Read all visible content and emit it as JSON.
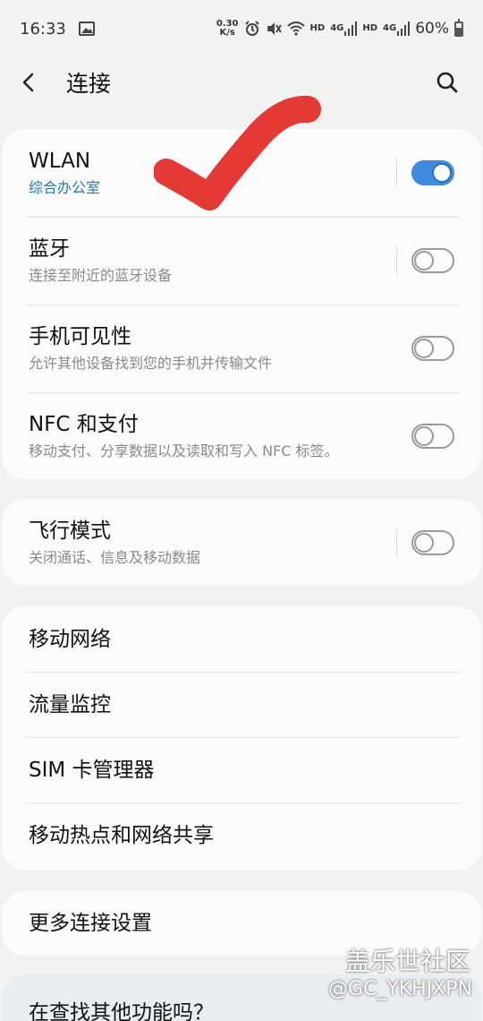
{
  "status_bar": {
    "time": "16:33",
    "net_speed_top": "0.30",
    "net_speed_bottom": "K/s",
    "hd1": "HD",
    "net1": "4G",
    "hd2": "HD",
    "net2": "4G",
    "battery": "60%"
  },
  "header": {
    "title": "连接"
  },
  "card1": {
    "rows": [
      {
        "title": "WLAN",
        "subtitle": "综合办公室",
        "toggle_on": true
      },
      {
        "title": "蓝牙",
        "subtitle": "连接至附近的蓝牙设备",
        "toggle_on": false
      },
      {
        "title": "手机可见性",
        "subtitle": "允许其他设备找到您的手机并传输文件",
        "toggle_on": false
      },
      {
        "title": "NFC 和支付",
        "subtitle": "移动支付、分享数据以及读取和写入 NFC 标签。",
        "toggle_on": false
      }
    ]
  },
  "card2": {
    "rows": [
      {
        "title": "飞行模式",
        "subtitle": "关闭通话、信息及移动数据",
        "toggle_on": false
      }
    ]
  },
  "card3": {
    "items": [
      "移动网络",
      "流量监控",
      "SIM 卡管理器",
      "移动热点和网络共享"
    ]
  },
  "card4": {
    "items": [
      "更多连接设置"
    ]
  },
  "card5": {
    "title": "在查找其他功能吗？"
  },
  "watermark": {
    "line1": "盖乐世社区",
    "line2": "@GC_YKHJXPN"
  },
  "colors": {
    "accent": "#3e8be0",
    "annotation": "#e53935"
  }
}
